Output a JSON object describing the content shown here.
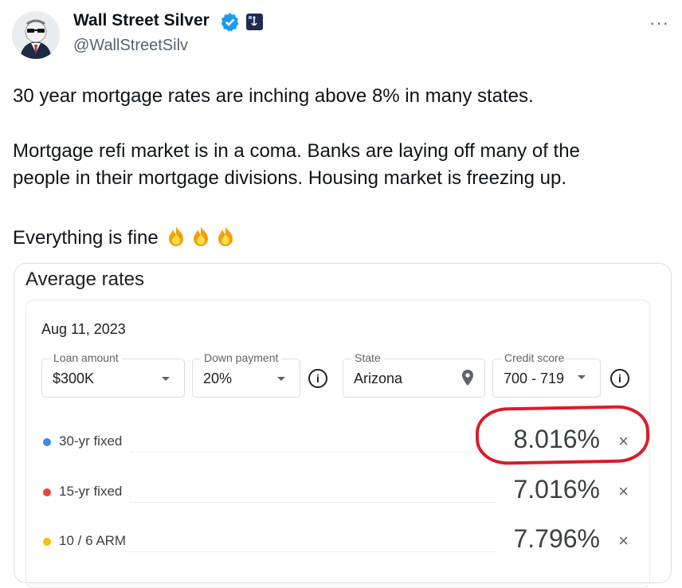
{
  "author": {
    "name": "Wall Street Silver",
    "handle": "@WallStreetSilv",
    "verified_icon": "verified-badge-icon",
    "affiliate_icon": "affiliate-badge-icon"
  },
  "more_icon": "more-dots-icon",
  "more_label": "···",
  "tweet": {
    "line1": "30 year mortgage rates are inching above 8% in many states.",
    "line2": "Mortgage refi market is in a coma. Banks are laying off many of the",
    "line3": "people in their mortgage divisions. Housing market is freezing up.",
    "line4": "Everything is fine",
    "emoji": [
      "fire-icon",
      "fire-icon",
      "fire-icon"
    ]
  },
  "card": {
    "title": "Average rates",
    "date": "Aug 11, 2023",
    "fields": {
      "loan_amount": {
        "label": "Loan amount",
        "value": "$300K"
      },
      "down_payment": {
        "label": "Down payment",
        "value": "20%"
      },
      "state": {
        "label": "State",
        "value": "Arizona"
      },
      "credit_score": {
        "label": "Credit score",
        "value": "700 - 719"
      }
    },
    "info_label": "i",
    "close_label": "×",
    "rates": [
      {
        "label": "30-yr fixed",
        "value": "8.016%",
        "color": "#4285f4"
      },
      {
        "label": "15-yr fixed",
        "value": "7.016%",
        "color": "#ea4335"
      },
      {
        "label": "10 / 6 ARM",
        "value": "7.796%",
        "color": "#fbbc04"
      }
    ]
  },
  "annotation_color": "#d91c2b"
}
